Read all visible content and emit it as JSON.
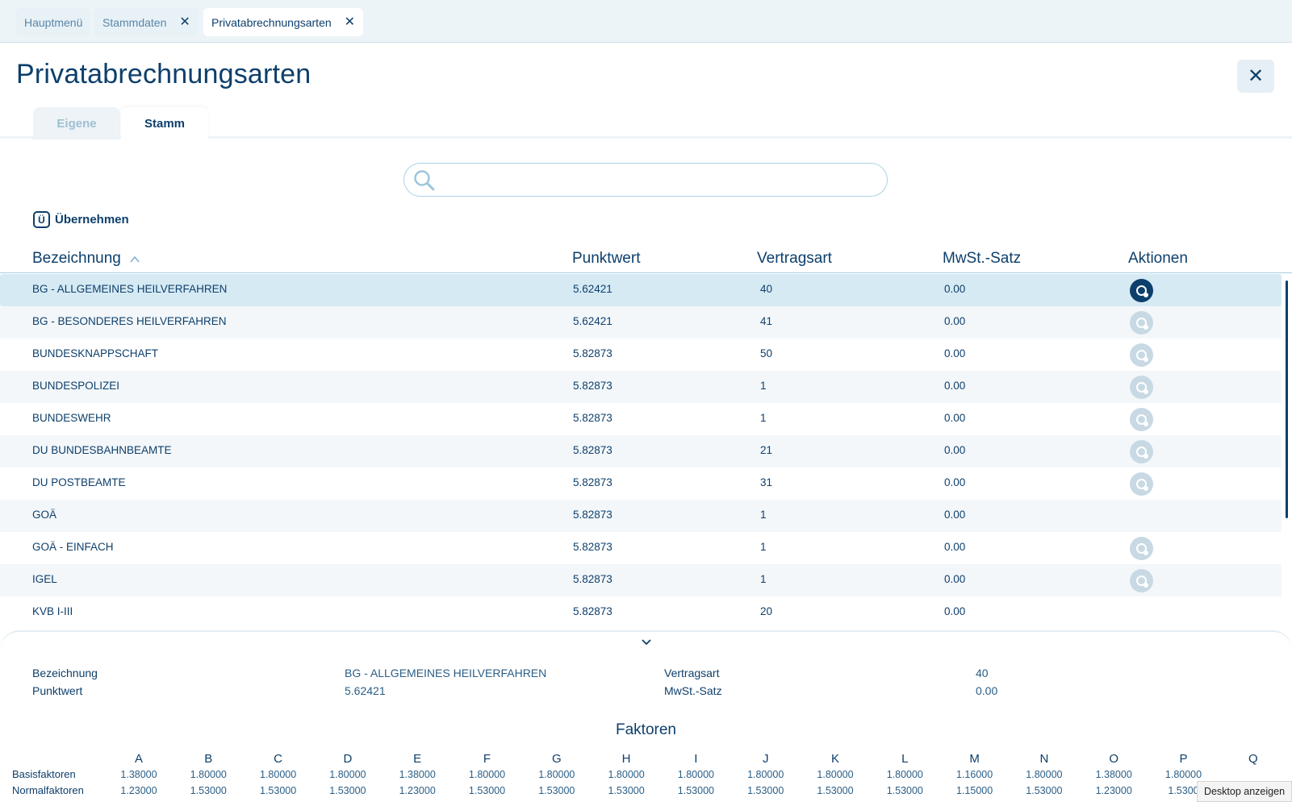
{
  "tabs": [
    {
      "label": "Hauptmenü",
      "closable": false,
      "active": false
    },
    {
      "label": "Stammdaten",
      "closable": true,
      "active": false
    },
    {
      "label": "Privatabrechnungsarten",
      "closable": true,
      "active": true
    }
  ],
  "tab_close_glyph": "✕",
  "page": {
    "title": "Privatabrechnungsarten",
    "close_glyph": "✕"
  },
  "subtabs": [
    {
      "label": "Eigene",
      "active": false
    },
    {
      "label": "Stamm",
      "active": true
    }
  ],
  "search": {
    "value": "",
    "placeholder": ""
  },
  "actions": {
    "uebernehmen_icon": "Ü",
    "uebernehmen_label": "Übernehmen"
  },
  "table": {
    "columns": [
      "Bezeichnung",
      "Punktwert",
      "Vertragsart",
      "MwSt.-Satz",
      "Aktionen"
    ],
    "sort_indicator": "^",
    "rows": [
      {
        "bezeichnung": "BG - ALLGEMEINES HEILVERFAHREN",
        "punktwert": "5.62421",
        "vertragsart": "40",
        "mwst": "0.00",
        "action": "active",
        "selected": true
      },
      {
        "bezeichnung": "BG - BESONDERES HEILVERFAHREN",
        "punktwert": "5.62421",
        "vertragsart": "41",
        "mwst": "0.00",
        "action": "inactive",
        "selected": false
      },
      {
        "bezeichnung": "BUNDESKNAPPSCHAFT",
        "punktwert": "5.82873",
        "vertragsart": "50",
        "mwst": "0.00",
        "action": "inactive",
        "selected": false
      },
      {
        "bezeichnung": "BUNDESPOLIZEI",
        "punktwert": "5.82873",
        "vertragsart": "1",
        "mwst": "0.00",
        "action": "inactive",
        "selected": false
      },
      {
        "bezeichnung": "BUNDESWEHR",
        "punktwert": "5.82873",
        "vertragsart": "1",
        "mwst": "0.00",
        "action": "inactive",
        "selected": false
      },
      {
        "bezeichnung": "DU BUNDESBAHNBEAMTE",
        "punktwert": "5.82873",
        "vertragsart": "21",
        "mwst": "0.00",
        "action": "inactive",
        "selected": false
      },
      {
        "bezeichnung": "DU POSTBEAMTE",
        "punktwert": "5.82873",
        "vertragsart": "31",
        "mwst": "0.00",
        "action": "inactive",
        "selected": false
      },
      {
        "bezeichnung": "GOÄ",
        "punktwert": "5.82873",
        "vertragsart": "1",
        "mwst": "0.00",
        "action": "none",
        "selected": false
      },
      {
        "bezeichnung": "GOÄ - EINFACH",
        "punktwert": "5.82873",
        "vertragsart": "1",
        "mwst": "0.00",
        "action": "inactive",
        "selected": false
      },
      {
        "bezeichnung": "IGEL",
        "punktwert": "5.82873",
        "vertragsart": "1",
        "mwst": "0.00",
        "action": "inactive",
        "selected": false
      },
      {
        "bezeichnung": "KVB I-III",
        "punktwert": "5.82873",
        "vertragsart": "20",
        "mwst": "0.00",
        "action": "none",
        "selected": false
      }
    ]
  },
  "detail": {
    "chevron": "⌄",
    "bezeichnung_label": "Bezeichnung",
    "bezeichnung_value": "BG - ALLGEMEINES HEILVERFAHREN",
    "punktwert_label": "Punktwert",
    "punktwert_value": "5.62421",
    "vertragsart_label": "Vertragsart",
    "vertragsart_value": "40",
    "mwst_label": "MwSt.-Satz",
    "mwst_value": "0.00",
    "faktoren_title": "Faktoren",
    "faktoren": {
      "columns": [
        "A",
        "B",
        "C",
        "D",
        "E",
        "F",
        "G",
        "H",
        "I",
        "J",
        "K",
        "L",
        "M",
        "N",
        "O",
        "P",
        "Q"
      ],
      "rows": [
        {
          "label": "Basisfaktoren",
          "values": [
            "1.38000",
            "1.80000",
            "1.80000",
            "1.80000",
            "1.38000",
            "1.80000",
            "1.80000",
            "1.80000",
            "1.80000",
            "1.80000",
            "1.80000",
            "1.80000",
            "1.16000",
            "1.80000",
            "1.38000",
            "1.80000",
            ""
          ]
        },
        {
          "label": "Normalfaktoren",
          "values": [
            "1.23000",
            "1.53000",
            "1.53000",
            "1.53000",
            "1.23000",
            "1.53000",
            "1.53000",
            "1.53000",
            "1.53000",
            "1.53000",
            "1.53000",
            "1.53000",
            "1.15000",
            "1.53000",
            "1.23000",
            "1.5300",
            ""
          ]
        }
      ]
    }
  },
  "tooltip": "Desktop anzeigen",
  "colors": {
    "primary": "#0d3f6b",
    "selected_row": "#d6eaf4",
    "alt_row": "#f3f7fa",
    "inactive_action": "#c8d9e4"
  }
}
